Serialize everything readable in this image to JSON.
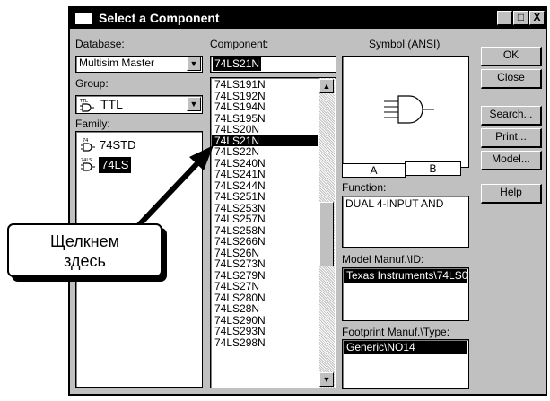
{
  "window": {
    "title": "Select a Component",
    "minimize_label": "_",
    "maximize_label": "□",
    "close_label": "X"
  },
  "database": {
    "label": "Database:",
    "value": "Multisim Master"
  },
  "group": {
    "label": "Group:",
    "icon_caption": "TTL",
    "value": "TTL"
  },
  "family": {
    "label": "Family:",
    "items": [
      {
        "icon_caption": "74",
        "label": "74STD",
        "selected": false
      },
      {
        "icon_caption": "74LS",
        "label": "74LS",
        "selected": true
      }
    ]
  },
  "component": {
    "label": "Component:",
    "value": "74LS21N",
    "items": [
      "74LS191N",
      "74LS192N",
      "74LS194N",
      "74LS195N",
      "74LS20N",
      "74LS21N",
      "74LS22N",
      "74LS240N",
      "74LS241N",
      "74LS244N",
      "74LS251N",
      "74LS253N",
      "74LS257N",
      "74LS258N",
      "74LS266N",
      "74LS26N",
      "74LS273N",
      "74LS279N",
      "74LS27N",
      "74LS280N",
      "74LS28N",
      "74LS290N",
      "74LS293N",
      "74LS298N"
    ],
    "selected_index": 5
  },
  "symbol": {
    "label": "Symbol (ANSI)",
    "tabs": [
      "A",
      "B"
    ],
    "icon": "and-gate-icon"
  },
  "function": {
    "label": "Function:",
    "value": "DUAL 4-INPUT AND"
  },
  "model": {
    "label": "Model Manuf.\\ID:",
    "value": "Texas Instruments\\74LS0"
  },
  "footprint": {
    "label": "Footprint Manuf.\\Type:",
    "value": "Generic\\NO14"
  },
  "buttons": {
    "ok": "OK",
    "close": "Close",
    "search": "Search...",
    "print": "Print...",
    "model": "Model...",
    "help": "Help"
  },
  "callout": {
    "line1": "Щелкнем",
    "line2": "здесь"
  },
  "colors": {
    "dialog_face": "#c0c0c0",
    "title_bar": "#000000",
    "selection": "#000000"
  }
}
